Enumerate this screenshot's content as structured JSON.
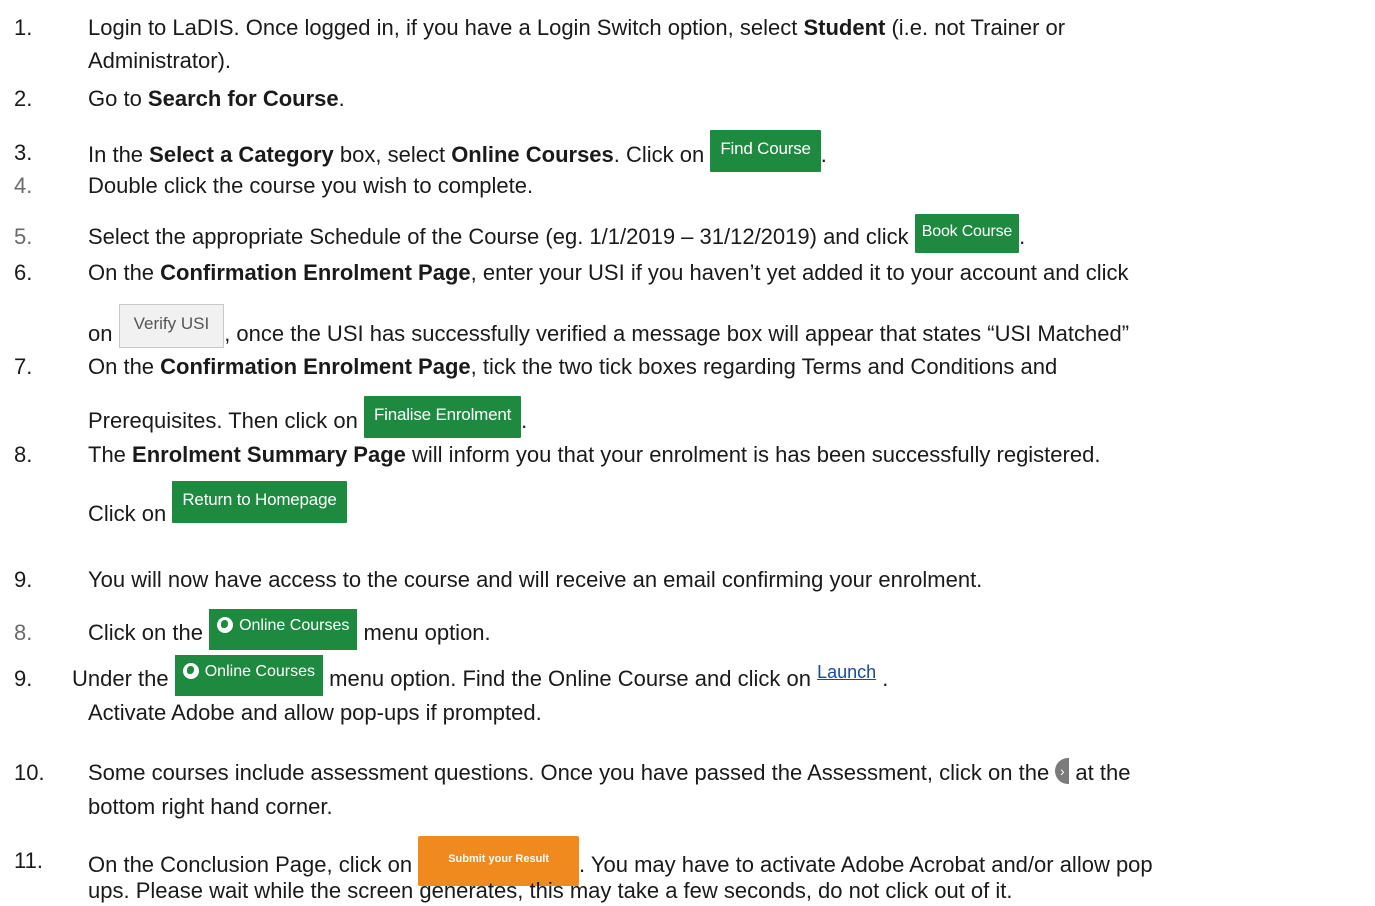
{
  "steps": [
    {
      "num": "1.",
      "lines": [
        [
          "Login to LaDIS. Once logged in, if you have a Login Switch option, select ",
          {
            "b": "Student"
          },
          " (i.e. not Trainer or"
        ],
        [
          "Administrator)."
        ]
      ]
    },
    {
      "num": "2.",
      "lines": [
        [
          "Go to ",
          {
            "b": "Search for Course"
          },
          "."
        ]
      ]
    },
    {
      "num": "3.",
      "lines": [
        [
          "In the ",
          {
            "b": "Select a Category"
          },
          " box, select ",
          {
            "b": "Online Courses"
          },
          ". Click on "
        ]
      ]
    },
    {
      "num": "4.",
      "lines": [
        [
          "Double click the course you wish to complete."
        ]
      ]
    },
    {
      "num": "5.",
      "lines": [
        [
          "Select the appropriate Schedule of the Course (eg. 1/1/2019 – 31/12/2019) and click "
        ]
      ]
    },
    {
      "num": "6.",
      "lines": [
        [
          "On the ",
          {
            "b": "Confirmation Enrolment Page"
          },
          ", enter your USI if you haven’t yet added it to your account and click"
        ],
        [
          "on ",
          ", once the USI has successfully verified a message box will appear that states “USI Matched”"
        ]
      ]
    },
    {
      "num": "7.",
      "lines": [
        [
          "On the ",
          {
            "b": "Confirmation Enrolment Page"
          },
          ", tick the two tick boxes regarding Terms and Conditions and"
        ],
        [
          "Prerequisites. Then click on "
        ]
      ]
    },
    {
      "num": "8.",
      "lines": [
        [
          "The ",
          {
            "b": "Enrolment Summary Page"
          },
          " will inform you that your enrolment is has been successfully registered."
        ],
        [
          "Click on "
        ]
      ]
    },
    {
      "num": "9.",
      "lines": [
        [
          "You will now have access to the course and will receive an email confirming your enrolment."
        ]
      ]
    },
    {
      "num": "8.",
      "lines": [
        [
          "Click on the ",
          " menu option."
        ]
      ]
    },
    {
      "num": "9.",
      "lines": [
        [
          "Under the ",
          " menu option. Find the Online Course and click on ",
          " ."
        ],
        [
          "Activate Adobe and allow pop-ups if prompted."
        ]
      ]
    },
    {
      "num": "10.",
      "lines": [
        [
          "Some courses include assessment questions.  Once you have passed the Assessment, click on the ",
          " at the"
        ],
        [
          "bottom right hand corner."
        ]
      ]
    },
    {
      "num": "11.",
      "lines": [
        [
          "On the Conclusion Page, click on ",
          ". You may have to activate Adobe Acrobat and/or allow pop"
        ],
        [
          "ups. Please wait while the screen generates, this may take a few seconds, do not click out of it."
        ]
      ]
    }
  ],
  "buttons": {
    "find_course": "Find Course",
    "book_course": "Book Course",
    "verify_usi": "Verify USI",
    "finalise_enrolment": "Finalise Enrolment",
    "return_homepage": "Return to Homepage",
    "online_courses": "Online Courses",
    "launch": "Launch",
    "submit_result": "Submit your Result",
    "next_icon": "chevron-right-icon"
  },
  "colors": {
    "green_button": "#1d8a3f",
    "orange_button": "#f08a1e",
    "link": "#1a4aa0"
  }
}
